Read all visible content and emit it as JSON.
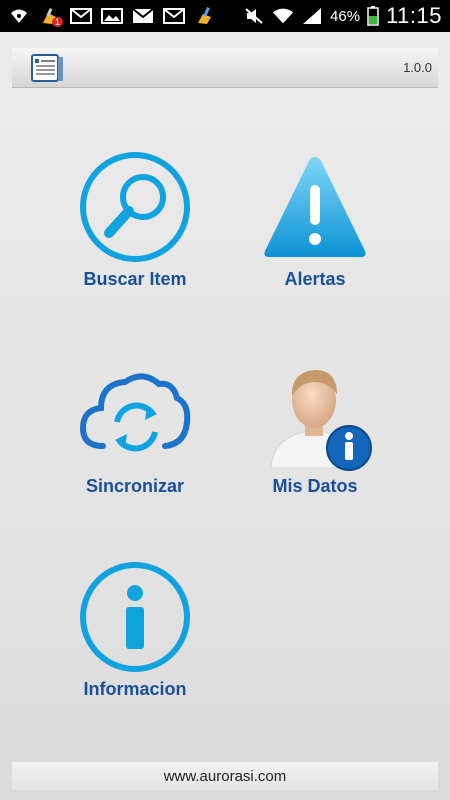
{
  "status_bar": {
    "battery_percent": "46%",
    "time": "11:15",
    "notification_badge": "1",
    "icons": [
      "wifi-hotspot-icon",
      "cleaner-notification-icon",
      "gmail-icon",
      "email-icon",
      "gallery-icon",
      "gmail-icon",
      "email-icon",
      "cleaner-icon",
      "mute-icon",
      "wifi-icon",
      "signal-icon",
      "battery-icon"
    ]
  },
  "header": {
    "version": "1.0.0",
    "logo_icon": "notebook-icon"
  },
  "menu": {
    "search": {
      "label": "Buscar Item",
      "icon": "search-icon"
    },
    "alerts": {
      "label": "Alertas",
      "icon": "warning-icon"
    },
    "sync": {
      "label": "Sincronizar",
      "icon": "cloud-sync-icon"
    },
    "my_data": {
      "label": "Mis Datos",
      "icon": "user-info-icon"
    },
    "info": {
      "label": "Informacion",
      "icon": "info-icon"
    }
  },
  "footer": {
    "url": "www.aurorasi.com"
  },
  "colors": {
    "accent_blue": "#11a3df",
    "label_blue": "#1a4f9c",
    "sync_blue": "#1c73c9"
  }
}
